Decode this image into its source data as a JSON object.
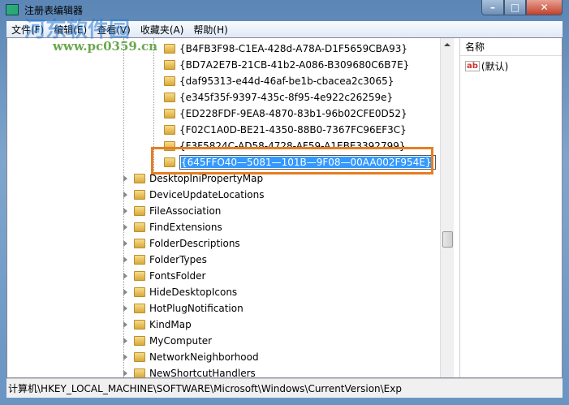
{
  "window": {
    "title": "注册表编辑器",
    "minimize": "–",
    "maximize": "□",
    "close": "✕"
  },
  "menu": [
    "文件(F)",
    "编辑(E)",
    "查看(V)",
    "收藏夹(A)",
    "帮助(H)"
  ],
  "tree": {
    "subkeys": [
      "{B4FB3F98-C1EA-428d-A78A-D1F5659CBA93}",
      "{BD7A2E7B-21CB-41b2-A086-B309680C6B7E}",
      "{daf95313-e44d-46af-be1b-cbacea2c3065}",
      "{e345f35f-9397-435c-8f95-4e922c26259e}",
      "{ED228FDF-9EA8-4870-83b1-96b02CFE0D52}",
      "{F02C1A0D-BE21-4350-88B0-7367FC96EF3C}",
      "{F3F5824C-AD58-4728-AF59-A1EBE3392799}"
    ],
    "editing_value": "{645FFO40—5081—101B—9F08—00AA002F954E}",
    "keys": [
      "DesktopIniPropertyMap",
      "DeviceUpdateLocations",
      "FileAssociation",
      "FindExtensions",
      "FolderDescriptions",
      "FolderTypes",
      "FontsFolder",
      "HideDesktopIcons",
      "HotPlugNotification",
      "KindMap",
      "MyComputer",
      "NetworkNeighborhood",
      "NewShortcutHandlers"
    ]
  },
  "right_panel": {
    "column_header": "名称",
    "default_value": "(默认)",
    "value_icon": "ab"
  },
  "status": "计算机\\HKEY_LOCAL_MACHINE\\SOFTWARE\\Microsoft\\Windows\\CurrentVersion\\Exp",
  "watermark": {
    "text": "河东软件园",
    "url": "www.pc0359.cn"
  },
  "colors": {
    "highlight": "#e67e22",
    "selection": "#3399ff"
  }
}
